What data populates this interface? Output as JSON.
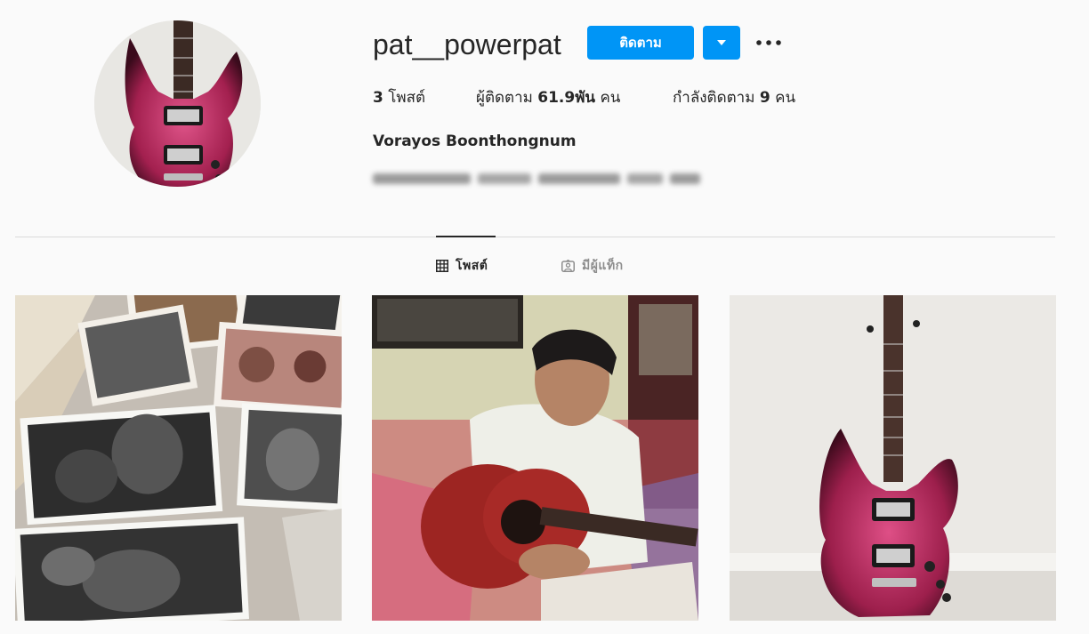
{
  "profile": {
    "username": "pat__powerpat",
    "follow_label": "ติดตาม",
    "full_name": "Vorayos Boonthongnum",
    "avatar_alt": "guitar-avatar"
  },
  "stats": {
    "posts_count": "3",
    "posts_label": "โพสต์",
    "followers_label": "ผู้ติดตาม",
    "followers_count": "61.9พัน",
    "followers_unit": "คน",
    "following_label": "กำลังติดตาม",
    "following_count": "9",
    "following_unit": "คน"
  },
  "tabs": {
    "posts": "โพสต์",
    "tagged": "มีผู้แท็ก"
  },
  "icons": {
    "dropdown": "chevron-down-icon",
    "more": "more-options-icon",
    "grid": "grid-icon",
    "tagged": "tagged-user-icon"
  },
  "colors": {
    "accent": "#0095f6",
    "text": "#262626",
    "muted": "#8e8e8e",
    "divider": "#dbdbdb",
    "guitar": "#b02a5a"
  },
  "posts": [
    {
      "subject": "tattoo-drawings"
    },
    {
      "subject": "boy-with-acoustic-guitar"
    },
    {
      "subject": "electric-guitar"
    }
  ]
}
